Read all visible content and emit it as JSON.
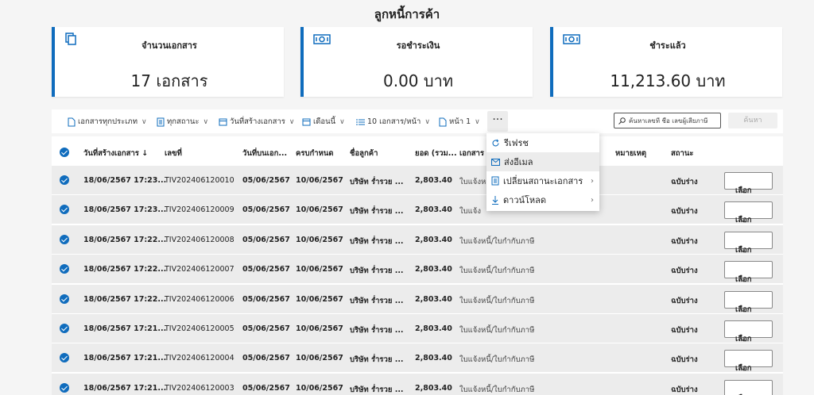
{
  "page_title": "ลูกหนี้การค้า",
  "cards": [
    {
      "label": "จำนวนเอกสาร",
      "value": "17 เอกสาร",
      "icon": "documents-icon"
    },
    {
      "label": "รอชำระเงิน",
      "value": "0.00 บาท",
      "icon": "money-icon"
    },
    {
      "label": "ชำระแล้ว",
      "value": "11,213.60 บาท",
      "icon": "money-icon"
    }
  ],
  "toolbar": {
    "doc_type": "เอกสารทุกประเภท",
    "status": "ทุกสถานะ",
    "date_field": "วันที่สร้างเอกสาร",
    "period": "เดือนนี้",
    "page_size": "10 เอกสาร/หน้า",
    "page": "หน้า 1",
    "more": "···",
    "search_placeholder": "ค้นหาเลขที่ ชื่อ เลขผู้เสียภาษี",
    "search_button": "ค้นหา"
  },
  "columns": {
    "created": "วันที่สร้างเอกสาร ↓",
    "number": "เลขที่",
    "issue_date": "วันที่บนเอก...",
    "due": "ครบกำหนด",
    "customer": "ชื่อลูกค้า",
    "amount": "ยอด (รวม...",
    "doc": "เอกสาร",
    "note": "หมายเหตุ",
    "status": "สถานะ"
  },
  "rows": [
    {
      "created": "18/06/2567 17:23...",
      "number": "TIV202406120010",
      "issue_date": "05/06/2567",
      "due": "10/06/2567",
      "customer": "บริษัท ร่ำรวย ...",
      "amount": "2,803.40",
      "doc": "ใบแจ้งห",
      "status": "ฉบับร่าง",
      "action": "เลือก"
    },
    {
      "created": "18/06/2567 17:23...",
      "number": "TIV202406120009",
      "issue_date": "05/06/2567",
      "due": "10/06/2567",
      "customer": "บริษัท ร่ำรวย ...",
      "amount": "2,803.40",
      "doc": "ใบแจ้ง",
      "status": "ฉบับร่าง",
      "action": "เลือก"
    },
    {
      "created": "18/06/2567 17:22...",
      "number": "TIV202406120008",
      "issue_date": "05/06/2567",
      "due": "10/06/2567",
      "customer": "บริษัท ร่ำรวย ...",
      "amount": "2,803.40",
      "doc": "ใบแจ้งหนี้/ใบกำกับภาษี",
      "status": "ฉบับร่าง",
      "action": "เลือก"
    },
    {
      "created": "18/06/2567 17:22...",
      "number": "TIV202406120007",
      "issue_date": "05/06/2567",
      "due": "10/06/2567",
      "customer": "บริษัท ร่ำรวย ...",
      "amount": "2,803.40",
      "doc": "ใบแจ้งหนี้/ใบกำกับภาษี",
      "status": "ฉบับร่าง",
      "action": "เลือก"
    },
    {
      "created": "18/06/2567 17:22...",
      "number": "TIV202406120006",
      "issue_date": "05/06/2567",
      "due": "10/06/2567",
      "customer": "บริษัท ร่ำรวย ...",
      "amount": "2,803.40",
      "doc": "ใบแจ้งหนี้/ใบกำกับภาษี",
      "status": "ฉบับร่าง",
      "action": "เลือก"
    },
    {
      "created": "18/06/2567 17:21...",
      "number": "TIV202406120005",
      "issue_date": "05/06/2567",
      "due": "10/06/2567",
      "customer": "บริษัท ร่ำรวย ...",
      "amount": "2,803.40",
      "doc": "ใบแจ้งหนี้/ใบกำกับภาษี",
      "status": "ฉบับร่าง",
      "action": "เลือก"
    },
    {
      "created": "18/06/2567 17:21...",
      "number": "TIV202406120004",
      "issue_date": "05/06/2567",
      "due": "10/06/2567",
      "customer": "บริษัท ร่ำรวย ...",
      "amount": "2,803.40",
      "doc": "ใบแจ้งหนี้/ใบกำกับภาษี",
      "status": "ฉบับร่าง",
      "action": "เลือก"
    },
    {
      "created": "18/06/2567 17:21...",
      "number": "TIV202406120003",
      "issue_date": "05/06/2567",
      "due": "10/06/2567",
      "customer": "บริษัท ร่ำรวย ...",
      "amount": "2,803.40",
      "doc": "ใบแจ้งหนี้/ใบกำกับภาษี",
      "status": "ฉบับร่าง",
      "action": "เลือก"
    }
  ],
  "menu": [
    {
      "label": "รีเฟรช",
      "icon": "refresh-icon"
    },
    {
      "label": "ส่งอีเมล",
      "icon": "mail-icon"
    },
    {
      "label": "เปลี่ยนสถานะเอกสาร",
      "icon": "document-status-icon"
    },
    {
      "label": "ดาวน์โหลด",
      "icon": "download-icon"
    }
  ],
  "colors": {
    "accent": "#0f6cbd",
    "row_bg": "#ececec"
  }
}
